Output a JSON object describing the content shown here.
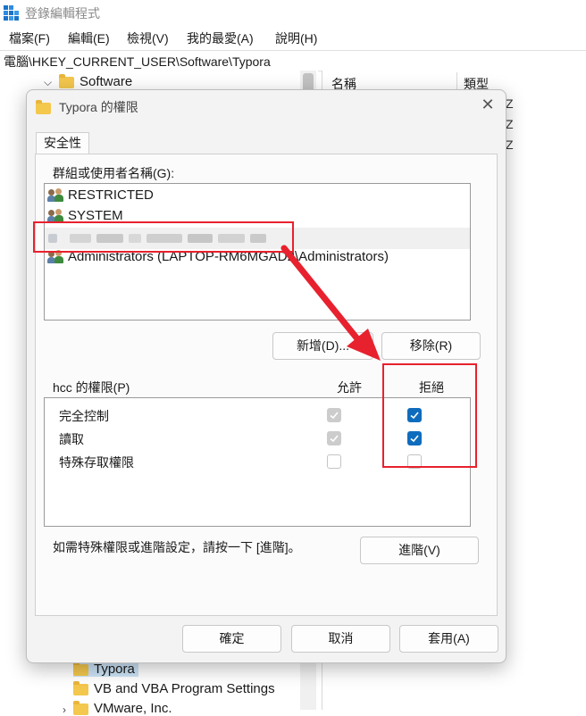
{
  "app": {
    "title": "登錄編輯程式",
    "menu": [
      "檔案(F)",
      "編輯(E)",
      "檢視(V)",
      "我的最愛(A)",
      "說明(H)"
    ],
    "address": "電腦\\HKEY_CURRENT_USER\\Software\\Typora"
  },
  "tree": {
    "items": [
      "Software",
      "Typora",
      "VB and VBA Program Settings",
      "VMware, Inc."
    ]
  },
  "list": {
    "columns": [
      "名稱",
      "類型"
    ],
    "fragments": [
      "Z",
      "Z",
      "Z"
    ]
  },
  "dialog": {
    "title": "Typora 的權限",
    "tab": "安全性",
    "group_label": "群組或使用者名稱(G):",
    "users": [
      "RESTRICTED",
      "SYSTEM",
      "Administrators (LAPTOP-RM6MGAD2\\Administrators)"
    ],
    "add_button": "新增(D)...",
    "remove_button": "移除(R)",
    "perm_label": "hcc 的權限(P)",
    "allow_col": "允許",
    "deny_col": "拒絕",
    "permissions": [
      {
        "name": "完全控制",
        "allow": true,
        "deny": true
      },
      {
        "name": "讀取",
        "allow": true,
        "deny": true
      },
      {
        "name": "特殊存取權限",
        "allow": false,
        "deny": false
      }
    ],
    "advanced_hint": "如需特殊權限或進階設定，請按一下 [進階]。",
    "advanced_button": "進階(V)",
    "ok_button": "確定",
    "cancel_button": "取消",
    "apply_button": "套用(A)"
  },
  "colors": {
    "accent": "#0f6cbd",
    "annotation": "#e8212e"
  }
}
